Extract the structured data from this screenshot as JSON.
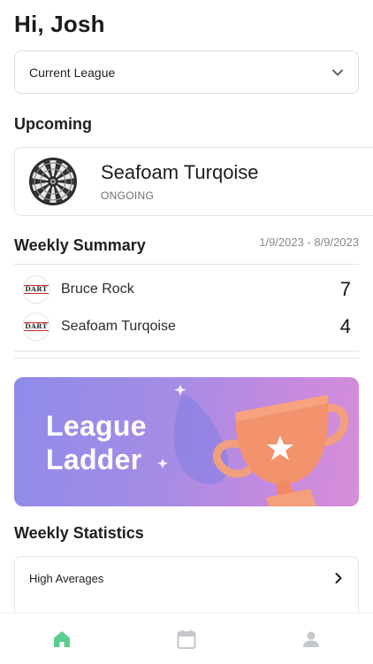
{
  "header": {
    "greeting": "Hi, Josh"
  },
  "league_select": {
    "label": "Current League",
    "icon": "chevron-down-icon"
  },
  "upcoming": {
    "title": "Upcoming",
    "card": {
      "name": "Seafoam Turqoise",
      "status": "ONGOING",
      "icon": "dartboard-icon"
    }
  },
  "weekly_summary": {
    "title": "Weekly Summary",
    "date_range": "1/9/2023 - 8/9/2023",
    "rows": [
      {
        "name": "Bruce Rock",
        "score": "7",
        "avatar_text": "DART"
      },
      {
        "name": "Seafoam Turqoise",
        "score": "4",
        "avatar_text": "DART"
      }
    ]
  },
  "banner": {
    "title_line1": "League",
    "title_line2": "Ladder",
    "icon": "trophy-icon"
  },
  "weekly_statistics": {
    "title": "Weekly Statistics",
    "items": [
      {
        "label": "High Averages",
        "icon": "chevron-right-icon"
      }
    ]
  },
  "tabbar": {
    "active_color": "#5ccf8e",
    "inactive_color": "#c4c8cc",
    "tabs": [
      {
        "name": "home",
        "icon": "home-icon",
        "active": true
      },
      {
        "name": "calendar",
        "icon": "calendar-icon",
        "active": false
      },
      {
        "name": "profile",
        "icon": "person-icon",
        "active": false
      }
    ]
  }
}
